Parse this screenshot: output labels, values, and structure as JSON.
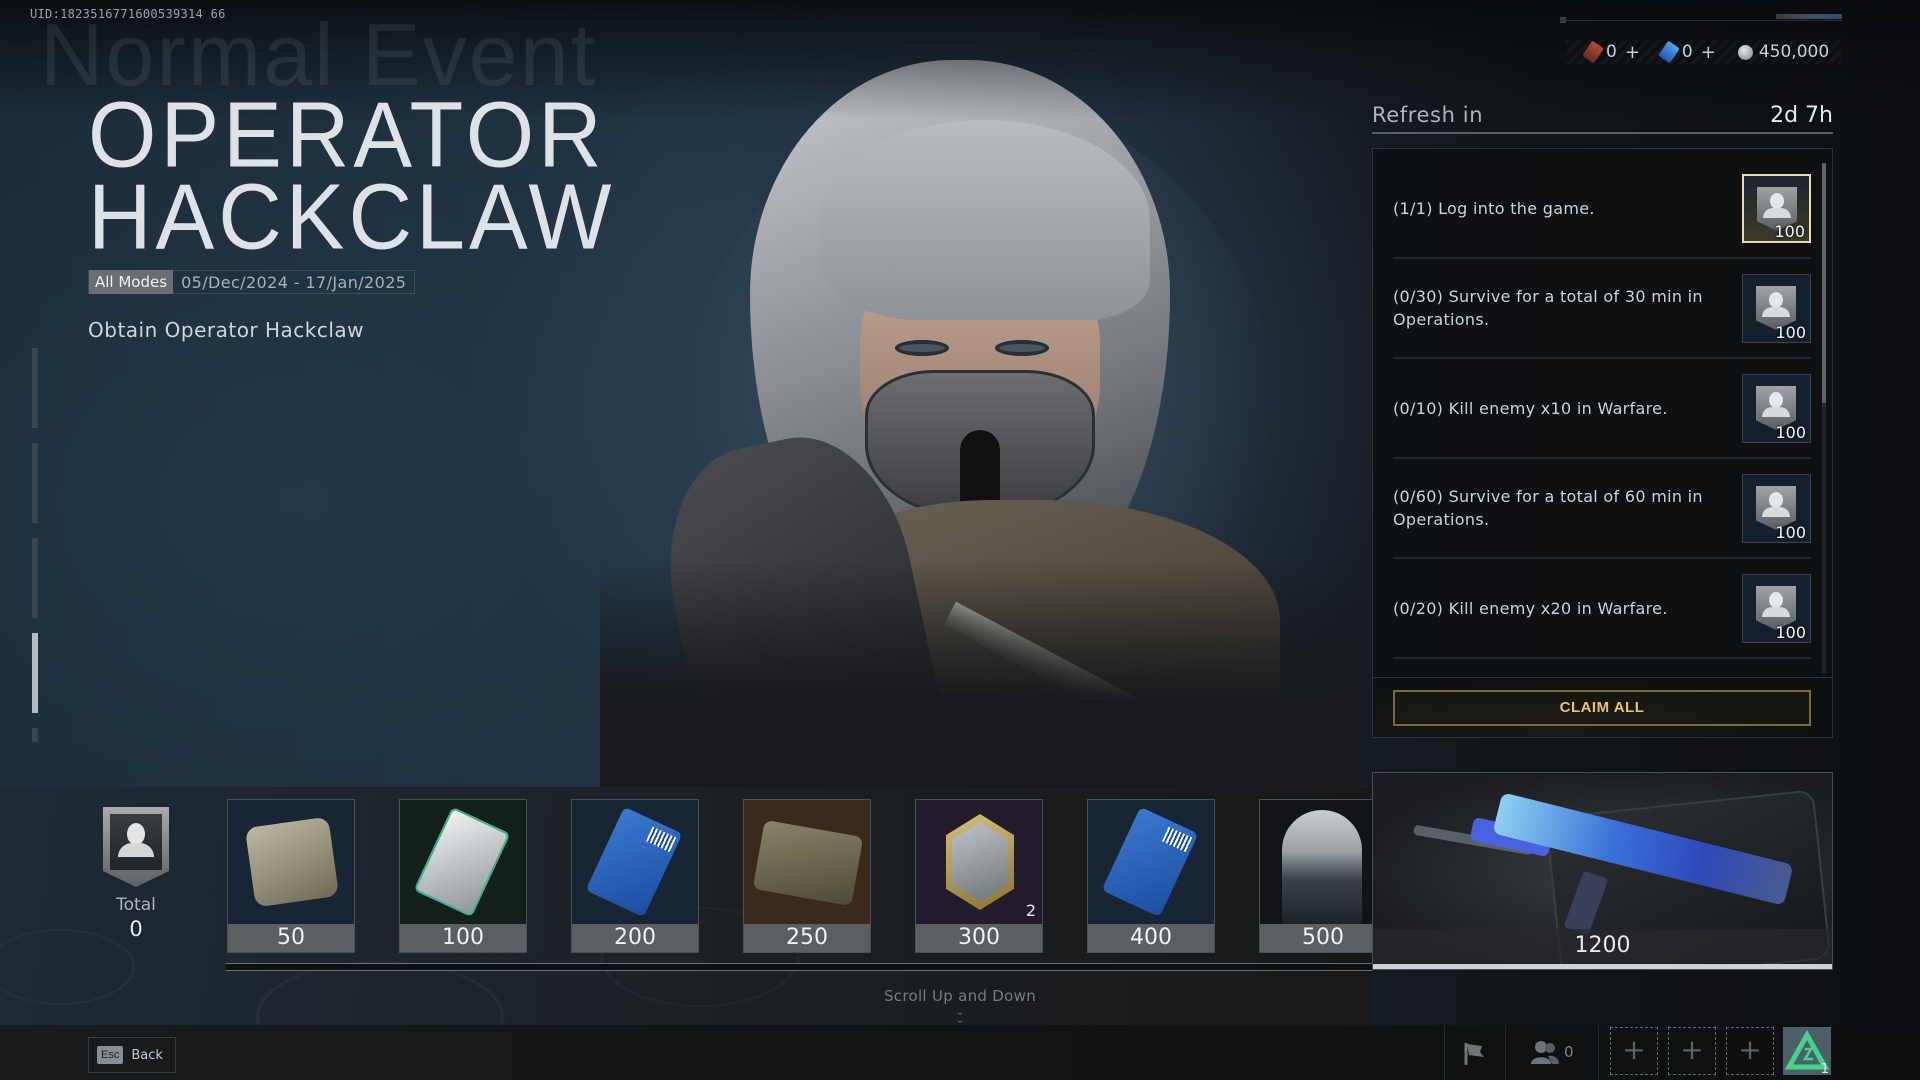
{
  "header": {
    "uid": "UID:1823516771600539314 66",
    "watermark": "Normal Event",
    "title_line1": "OPERATOR",
    "title_line2": "HACKCLAW",
    "mode_tag": "All Modes",
    "date_range": "05/Dec/2024 - 17/Jan/2025",
    "subtitle": "Obtain Operator Hackclaw"
  },
  "pager": {
    "total_pages": 5,
    "active_page": 4
  },
  "currency": [
    {
      "icon": "red-ticket-icon",
      "value": "0",
      "add": "+"
    },
    {
      "icon": "blue-ticket-icon",
      "value": "0",
      "add": "+"
    },
    {
      "icon": "coin-icon",
      "value": "450,000"
    }
  ],
  "refresh": {
    "label": "Refresh in",
    "time": "2d 7h"
  },
  "tasks": [
    {
      "text": "(1/1) Log into the game.",
      "reward_qty": "100",
      "completed": true
    },
    {
      "text": "(0/30) Survive for a total of 30 min in Operations.",
      "reward_qty": "100",
      "completed": false
    },
    {
      "text": "(0/10) Kill enemy x10 in Warfare.",
      "reward_qty": "100",
      "completed": false
    },
    {
      "text": "(0/60) Survive for a total of 60 min in Operations.",
      "reward_qty": "100",
      "completed": false
    },
    {
      "text": "(0/20) Kill enemy x20 in Warfare.",
      "reward_qty": "100",
      "completed": false
    }
  ],
  "claim_all_label": "CLAIM ALL",
  "total": {
    "label": "Total",
    "value": "0"
  },
  "tiers": [
    {
      "threshold": "50",
      "item": "supply-box",
      "count": ""
    },
    {
      "threshold": "100",
      "item": "silver-card",
      "count": ""
    },
    {
      "threshold": "200",
      "item": "blue-gti-card",
      "count": ""
    },
    {
      "threshold": "250",
      "item": "crate",
      "count": ""
    },
    {
      "threshold": "300",
      "item": "hex-badge",
      "count": "2"
    },
    {
      "threshold": "400",
      "item": "blue-gti-card",
      "count": ""
    },
    {
      "threshold": "500",
      "item": "operator-portrait",
      "count": ""
    }
  ],
  "big_reward": {
    "threshold": "1200",
    "item": "blue-rifle-skin"
  },
  "progress": {
    "current": 0,
    "max": 1200
  },
  "scroll_hint": "Scroll Up and Down",
  "footer": {
    "esc_key": "Esc",
    "back_label": "Back",
    "friends_count": "0",
    "rank_level": "1"
  }
}
